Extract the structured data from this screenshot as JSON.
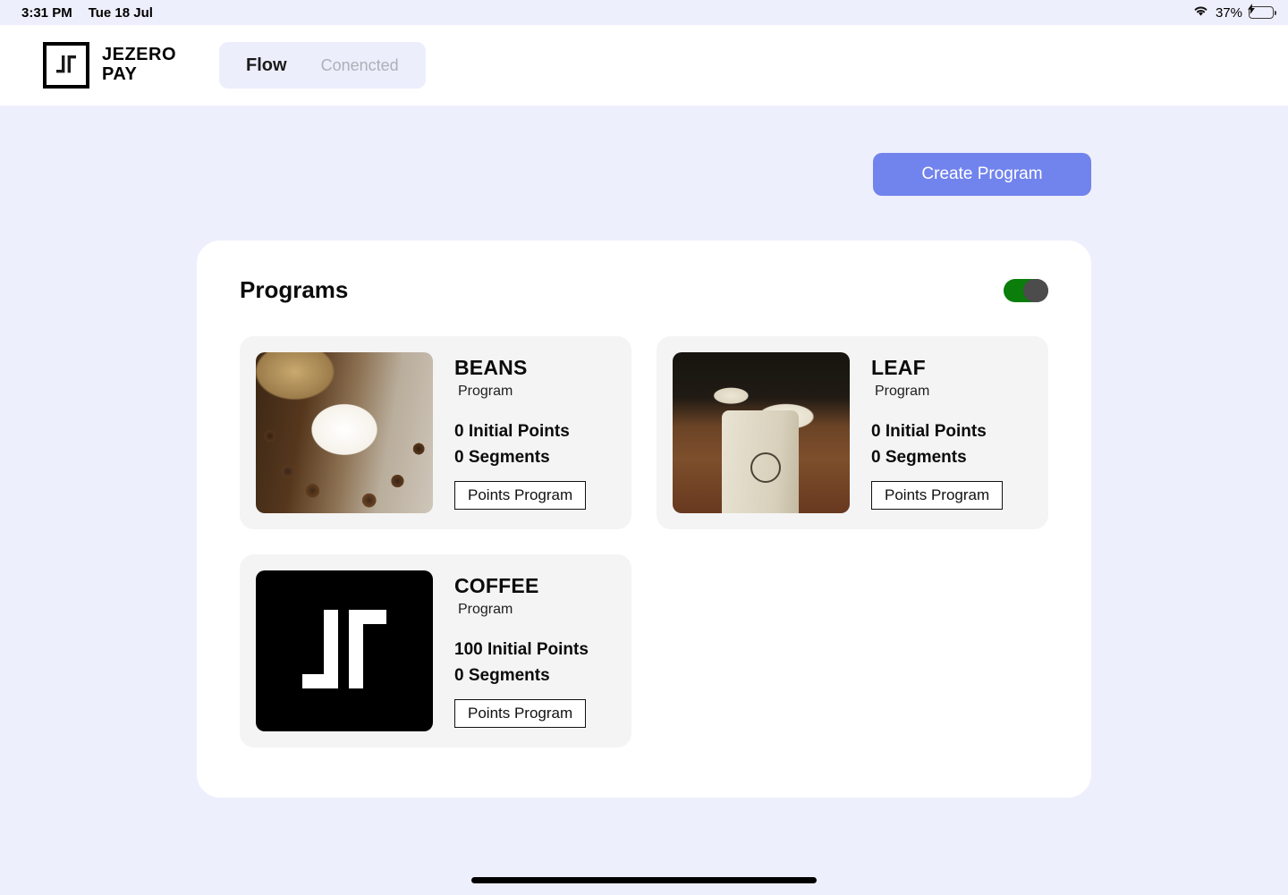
{
  "status_bar": {
    "time": "3:31 PM",
    "date": "Tue 18 Jul",
    "battery_percent": "37%",
    "wifi_icon": "wifi-icon",
    "battery_icon": "battery-charging-icon"
  },
  "header": {
    "brand_name_line1": "JEZERO",
    "brand_name_line2": "PAY",
    "logo_icon": "jezero-logo-icon",
    "tabs": [
      {
        "label": "Flow",
        "active": true
      },
      {
        "label": "Conencted",
        "active": false
      }
    ]
  },
  "actions": {
    "create_program_label": "Create Program"
  },
  "panel": {
    "title": "Programs",
    "toggle_on": true,
    "toggle_color_on": "#0a7d0a",
    "toggle_knob_color": "#4c4c4c"
  },
  "programs": [
    {
      "name": "BEANS",
      "subtitle": "Program",
      "initial_points": "0 Initial Points",
      "segments": "0 Segments",
      "button_label": "Points Program",
      "thumbnail": "coffee-cup-beans-photo"
    },
    {
      "name": "LEAF",
      "subtitle": "Program",
      "initial_points": "0 Initial Points",
      "segments": "0 Segments",
      "button_label": "Points Program",
      "thumbnail": "latte-mugs-photo"
    },
    {
      "name": "COFFEE",
      "subtitle": "Program",
      "initial_points": "100 Initial Points",
      "segments": "0 Segments",
      "button_label": "Points Program",
      "thumbnail": "jezero-logo-black-tile"
    }
  ],
  "colors": {
    "page_background": "#eeeffc",
    "card_background": "#ffffff",
    "tile_background": "#f4f4f4",
    "accent": "#7183ec",
    "tab_pill": "#eceefc"
  }
}
